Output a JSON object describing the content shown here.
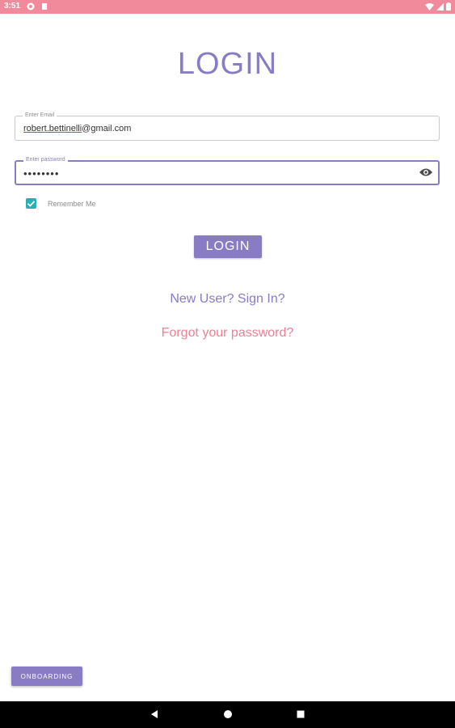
{
  "status_bar": {
    "time": "3:51",
    "icons": [
      "app-notification-icon",
      "sd-card-icon",
      "wifi-icon",
      "signal-icon",
      "battery-icon"
    ]
  },
  "page": {
    "title": "LOGIN"
  },
  "form": {
    "email": {
      "label": "Enter Email",
      "value_misspelled": "robert.bettinelli",
      "value_rest": "@gmail.com"
    },
    "password": {
      "label": "Enter password",
      "value": "••••••••",
      "toggle_icon": "eye-icon"
    },
    "remember": {
      "label": "Remember Me",
      "checked": true
    },
    "login_button": "LOGIN",
    "new_user_link": "New User? Sign In?",
    "forgot_link": "Forgot your password?"
  },
  "onboarding_button": "ONBOARDING",
  "nav": [
    "back-icon",
    "home-icon",
    "recents-icon"
  ],
  "colors": {
    "status_bar": "#f18b9b",
    "primary": "#8a7cc4",
    "accent": "#ef7f92",
    "checkbox": "#28b0b5"
  }
}
